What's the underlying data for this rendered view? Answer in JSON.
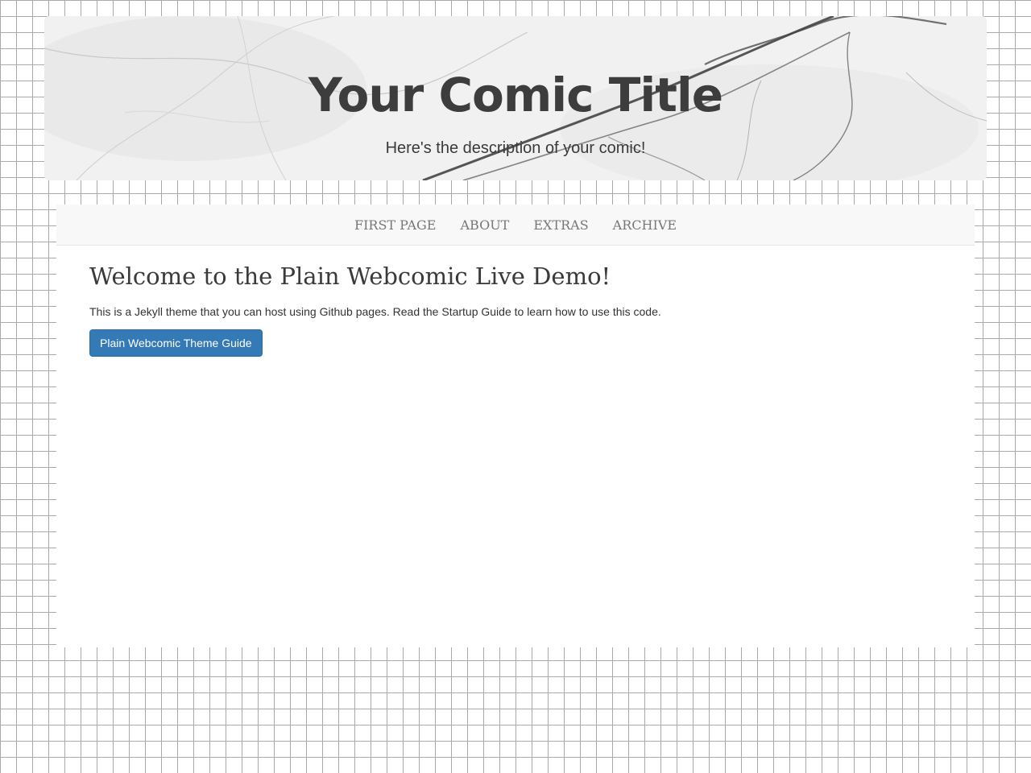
{
  "header": {
    "title": "Your Comic Title",
    "description": "Here's the description of your comic!"
  },
  "nav": {
    "items": [
      {
        "label": "FIRST PAGE"
      },
      {
        "label": "ABOUT"
      },
      {
        "label": "EXTRAS"
      },
      {
        "label": "ARCHIVE"
      }
    ]
  },
  "main": {
    "heading": "Welcome to the Plain Webcomic Live Demo!",
    "intro": "This is a Jekyll theme that you can host using Github pages. Read the Startup Guide to learn how to use this code.",
    "button_label": "Plain Webcomic Theme Guide"
  },
  "colors": {
    "button_bg": "#337ab7",
    "navbar_bg": "#f8f8f8",
    "title_text": "#3d3d3d",
    "grid_line": "#a9a9a9"
  },
  "icons": {
    "banner_background": "marble-texture"
  }
}
